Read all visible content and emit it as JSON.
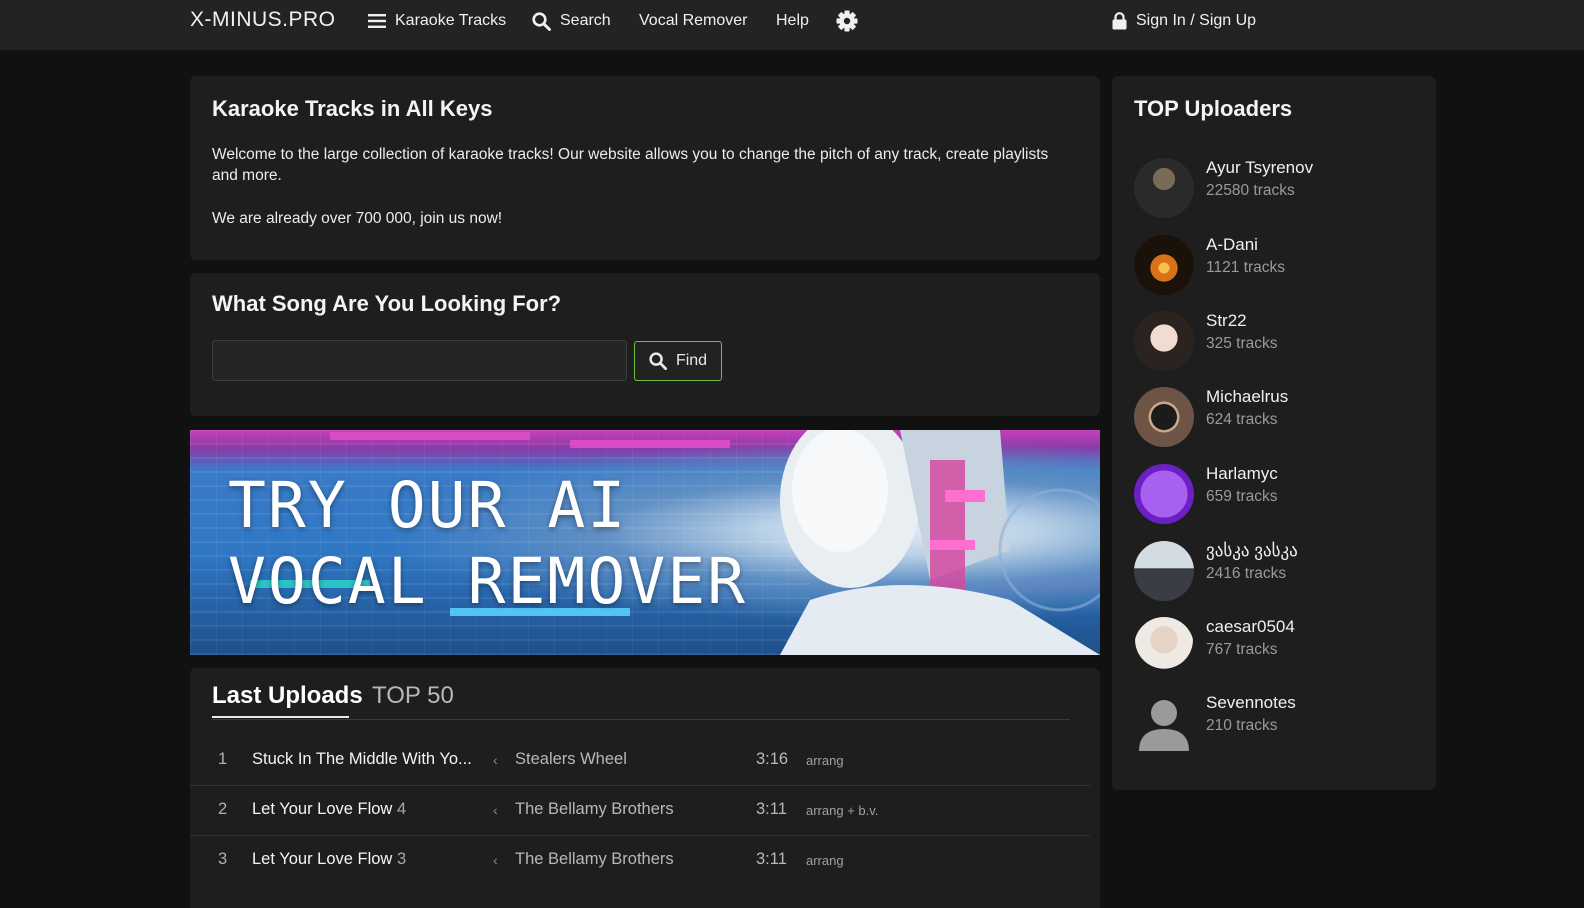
{
  "nav": {
    "brand": "X-MINUS.PRO",
    "items": [
      {
        "label": "Karaoke Tracks",
        "icon": "hamburger-icon"
      },
      {
        "label": "Search",
        "icon": "search-icon"
      },
      {
        "label": "Vocal Remover"
      },
      {
        "label": "Help"
      }
    ],
    "settings_icon": "gear-icon",
    "signin": {
      "label": "Sign In / Sign Up",
      "icon": "lock-icon"
    }
  },
  "intro": {
    "title": "Karaoke Tracks in All Keys",
    "paragraph1": "Welcome to the large collection of karaoke tracks! Our website allows you to change the pitch of any track, create playlists and more.",
    "paragraph2": "We are already over 700 000, join us now!"
  },
  "search": {
    "title": "What Song Are You Looking For?",
    "input_value": "",
    "placeholder": "",
    "button_label": "Find"
  },
  "banner": {
    "line1": "TRY OUR AI",
    "line2": "VOCAL REMOVER"
  },
  "tabs": {
    "items": [
      "Last Uploads",
      "TOP 50"
    ],
    "active": "Last Uploads"
  },
  "tracks": [
    {
      "num": "1",
      "title": "Stuck In The Middle With Yo...",
      "version": "",
      "artist": "Stealers Wheel",
      "duration": "3:16",
      "tag": "arrang"
    },
    {
      "num": "2",
      "title": "Let Your Love Flow",
      "version": "4",
      "artist": "The Bellamy Brothers",
      "duration": "3:11",
      "tag": "arrang + b.v."
    },
    {
      "num": "3",
      "title": "Let Your Love Flow",
      "version": "3",
      "artist": "The Bellamy Brothers",
      "duration": "3:11",
      "tag": "arrang"
    }
  ],
  "top_uploaders": {
    "title": "TOP Uploaders",
    "users": [
      {
        "name": "Ayur Tsyrenov",
        "tracks": "22580 tracks",
        "avatar_color": "#3a3a3a"
      },
      {
        "name": "A-Dani",
        "tracks": "1121 tracks",
        "avatar_color": "#c77a1a"
      },
      {
        "name": "Str22",
        "tracks": "325 tracks",
        "avatar_color": "#e9d6cc"
      },
      {
        "name": "Michaelrus",
        "tracks": "624 tracks",
        "avatar_color": "#5a4a3e"
      },
      {
        "name": "Harlamyc",
        "tracks": "659 tracks",
        "avatar_color": "#8a3ed6"
      },
      {
        "name": "ვასკა ვასკა",
        "tracks": "2416 tracks",
        "avatar_color": "#b9c2cc"
      },
      {
        "name": "caesar0504",
        "tracks": "767 tracks",
        "avatar_color": "#d8cfc8"
      },
      {
        "name": "Sevennotes",
        "tracks": "210 tracks",
        "avatar_color": "#9a9a9a"
      }
    ]
  },
  "colors": {
    "background": "#111112",
    "card": "#1e1e1f",
    "topbar": "#232323",
    "find_border": "#6fbf3a"
  }
}
